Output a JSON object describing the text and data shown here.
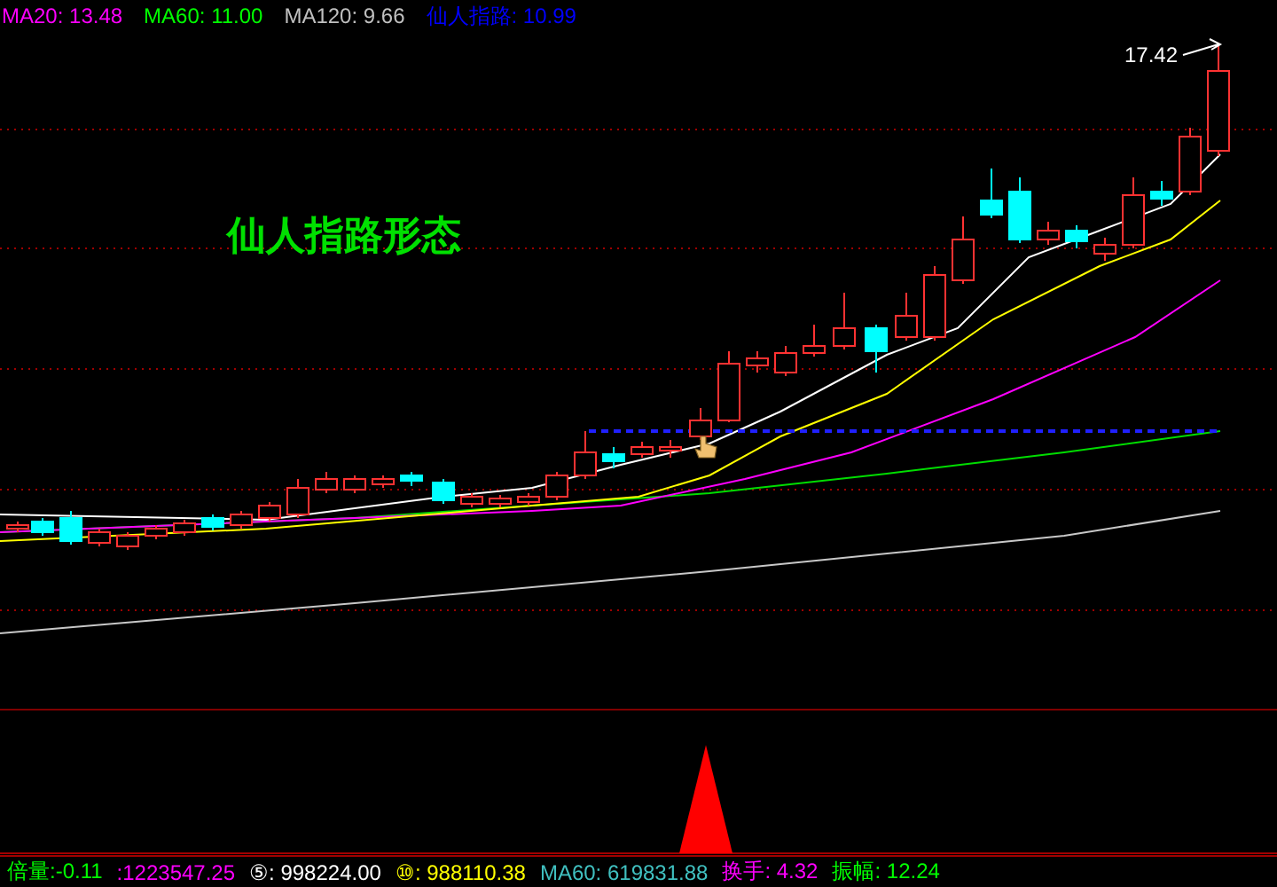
{
  "top_legend": [
    {
      "text": "MA20: 13.48",
      "color": "#ff00ff"
    },
    {
      "text": "MA60: 11.00",
      "color": "#00ff00"
    },
    {
      "text": "MA120: 9.66",
      "color": "#c0c0c0"
    },
    {
      "text": "仙人指路: 10.99",
      "color": "#0000ff"
    }
  ],
  "chart": {
    "pattern_label": "仙人指路形态",
    "high_price_label": "17.42"
  },
  "bottom_legend": [
    {
      "text": "倍量:-0.11",
      "color": "#00ff00"
    },
    {
      "text": ":1223547.25",
      "color": "#ff00ff"
    },
    {
      "text": "⑤: 998224.00",
      "color": "#ffffff"
    },
    {
      "text": "⑩: 988110.38",
      "color": "#ffff00"
    },
    {
      "text": "MA60: 619831.88",
      "color": "#40c0c0"
    },
    {
      "text": "换手: 4.32",
      "color": "#ff00ff"
    },
    {
      "text": "振幅: 12.24",
      "color": "#00ff00"
    }
  ]
}
